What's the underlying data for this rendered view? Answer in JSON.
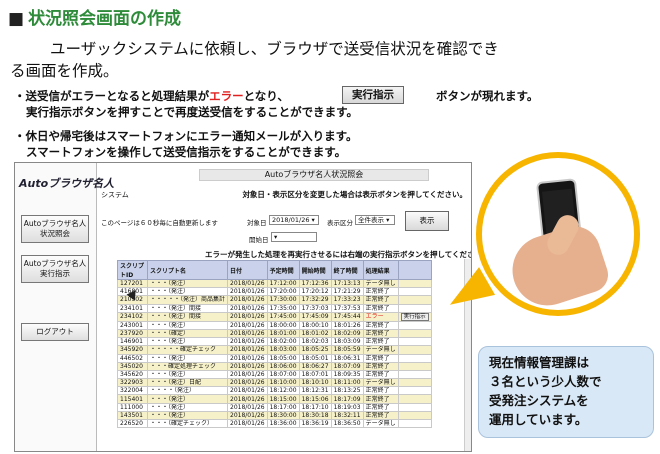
{
  "slide": {
    "title_mark": "■",
    "title": "状況照会画面の作成",
    "intro_line1": "ユーザックシステムに依頼し、ブラウザで送受信状況を確認でき",
    "intro_line2": "る画面を作成。"
  },
  "bullets": {
    "b1_pre": "・送受信が",
    "b1_err": "エラー",
    "b1_post": "となると処理結果が",
    "b1_err2": "エラー",
    "b1_post2": "となり、",
    "b1_tail": "ボタンが現れます。",
    "b1_line2": "実行指示ボタンを押すことで再度送受信をすることができます。",
    "b2_line1": "・休日や帰宅後はスマートフォンにエラー通知メールが入ります。",
    "b2_line2": "スマートフォンを操作して送受信指示をすることができます。",
    "inline_button": "実行指示"
  },
  "app": {
    "logo": "Autoブラウザ名人",
    "title": "Autoブラウザ名人状況照会",
    "system_label": "システム",
    "notice": "対象日・表示区分を変更した場合は表示ボタンを押してください。",
    "auto_refresh": "このページは６０秒毎に自動更新します",
    "date_label": "対象日",
    "date_value": "2018/01/26 ▾",
    "category_label": "表示区分",
    "category_value": "全件表示 ▾",
    "period_label": "開始日",
    "period_value": "▾",
    "show_button": "表示",
    "warning": "エラーが発生した処理を再実行させるには右端の実行指示ボタンを押してください。",
    "sidebar": {
      "btn1": [
        "Autoブラウザ名人",
        "状況照会"
      ],
      "btn2": [
        "Autoブラウザ名人",
        "実行指示"
      ],
      "btn3": "ログアウト"
    },
    "table": {
      "headers": [
        "スクリプトID",
        "スクリプト名",
        "日付",
        "予定時間",
        "開始時間",
        "終了時間",
        "処理結果",
        ""
      ],
      "rows": [
        [
          "127201",
          "・・・（発注）",
          "2018/01/26",
          "17:12:00",
          "17:12:36",
          "17:13:13",
          "データ無し",
          ""
        ],
        [
          "416801",
          "・・・（発注）",
          "2018/01/26",
          "17:20:00",
          "17:20:12",
          "17:21:29",
          "正常終了",
          ""
        ],
        [
          "210902",
          "・・・・・（発注）商品集計",
          "2018/01/26",
          "17:30:00",
          "17:32:29",
          "17:33:23",
          "正常終了",
          ""
        ],
        [
          "234101",
          "・・・（発注）間接",
          "2018/01/26",
          "17:35:00",
          "17:37:03",
          "17:37:53",
          "正常終了",
          ""
        ],
        [
          "234102",
          "・・・（発注）間接",
          "2018/01/26",
          "17:45:00",
          "17:45:09",
          "17:45:44",
          "エラー",
          "実行指示"
        ],
        [
          "243001",
          "・・・（発注）",
          "2018/01/26",
          "18:00:00",
          "18:00:10",
          "18:01:26",
          "正常終了",
          ""
        ],
        [
          "237920",
          "・・・（確定）",
          "2018/01/26",
          "18:01:00",
          "18:01:02",
          "18:02:09",
          "正常終了",
          ""
        ],
        [
          "146901",
          "・・・（発注）",
          "2018/01/26",
          "18:02:00",
          "18:02:03",
          "18:03:09",
          "正常終了",
          ""
        ],
        [
          "345920",
          "・・・・・確定チェック",
          "2018/01/26",
          "18:03:00",
          "18:05:25",
          "18:05:59",
          "データ無し",
          ""
        ],
        [
          "446502",
          "・・・（発注）",
          "2018/01/26",
          "18:05:00",
          "18:05:01",
          "18:06:31",
          "正常終了",
          ""
        ],
        [
          "345020",
          "・・・確定処理チェック",
          "2018/01/26",
          "18:06:00",
          "18:06:27",
          "18:07:09",
          "正常終了",
          ""
        ],
        [
          "345620",
          "・・・（発注）",
          "2018/01/26",
          "18:07:00",
          "18:07:01",
          "18:09:35",
          "正常終了",
          ""
        ],
        [
          "322903",
          "・・・（発注）日配",
          "2018/01/26",
          "18:10:00",
          "18:10:10",
          "18:11:00",
          "データ無し",
          ""
        ],
        [
          "322004",
          "・・・・（発注）",
          "2018/01/26",
          "18:12:00",
          "18:12:31",
          "18:13:25",
          "正常終了",
          ""
        ],
        [
          "115401",
          "・・・（発注）",
          "2018/01/26",
          "18:15:00",
          "18:15:06",
          "18:17:09",
          "正常終了",
          ""
        ],
        [
          "111000",
          "・・・（発注）",
          "2018/01/26",
          "18:17:00",
          "18:17:10",
          "18:19:03",
          "正常終了",
          ""
        ],
        [
          "143501",
          "・・・（発注）",
          "2018/01/26",
          "18:30:00",
          "18:30:18",
          "18:32:11",
          "正常終了",
          ""
        ],
        [
          "226520",
          "・・・（確定チェック）",
          "2018/01/26",
          "18:36:00",
          "18:36:19",
          "18:36:50",
          "データ無し",
          ""
        ]
      ]
    }
  },
  "info_box": {
    "line1": "現在情報管理課は",
    "line2": "３名という少人数で",
    "line3": "受発注システムを",
    "line4": "運用しています。"
  },
  "colors": {
    "title_green": "#2e8b3a",
    "error_red": "#e02020",
    "bubble_orange": "#f7b500",
    "info_bg": "#d9e8f6",
    "header_blue": "#c9d2ea",
    "row_yellow": "#f6f1c9"
  }
}
